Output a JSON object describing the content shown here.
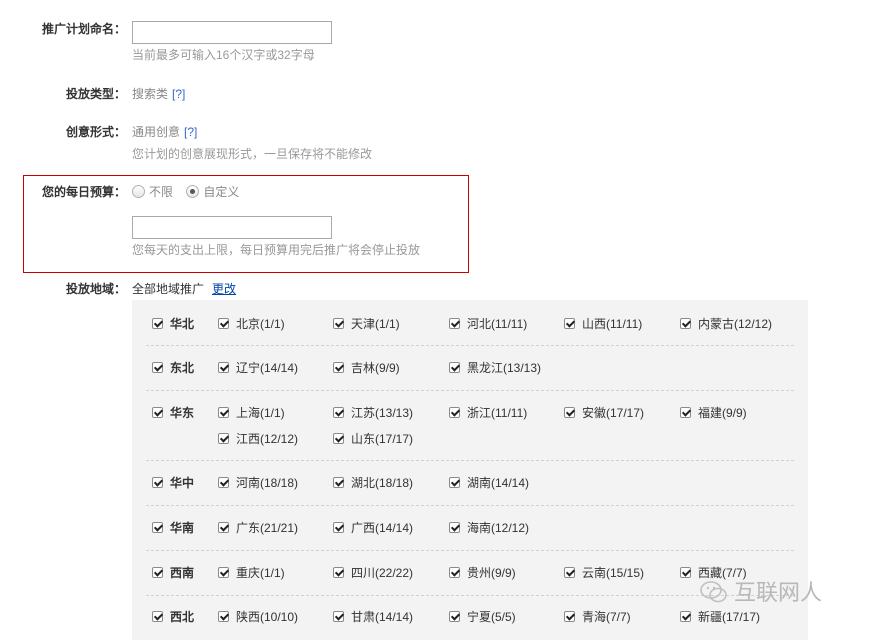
{
  "campaign_name": {
    "label": "推广计划命名：",
    "value": "",
    "hint": "当前最多可输入16个汉字或32字母"
  },
  "placement_type": {
    "label": "投放类型：",
    "value": "搜索类",
    "help": "[?]"
  },
  "creative_format": {
    "label": "创意形式：",
    "value": "通用创意",
    "help": "[?]",
    "hint": "您计划的创意展现形式，一旦保存将不能修改"
  },
  "daily_budget": {
    "label": "您的每日预算：",
    "options": [
      {
        "label": "不限",
        "selected": false
      },
      {
        "label": "自定义",
        "selected": true
      }
    ],
    "value": "",
    "hint": "您每天的支出上限，每日预算用完后推广将会停止投放",
    "highlight_color": "#cc0000"
  },
  "regions": {
    "label": "投放地域：",
    "value": "全部地域推广",
    "change_link": "更改",
    "groups": [
      {
        "name": "华北",
        "items": [
          "北京(1/1)",
          "天津(1/1)",
          "河北(11/11)",
          "山西(11/11)",
          "内蒙古(12/12)"
        ]
      },
      {
        "name": "东北",
        "items": [
          "辽宁(14/14)",
          "吉林(9/9)",
          "黑龙江(13/13)"
        ]
      },
      {
        "name": "华东",
        "items": [
          "上海(1/1)",
          "江苏(13/13)",
          "浙江(11/11)",
          "安徽(17/17)",
          "福建(9/9)",
          "江西(12/12)",
          "山东(17/17)"
        ]
      },
      {
        "name": "华中",
        "items": [
          "河南(18/18)",
          "湖北(18/18)",
          "湖南(14/14)"
        ]
      },
      {
        "name": "华南",
        "items": [
          "广东(21/21)",
          "广西(14/14)",
          "海南(12/12)"
        ]
      },
      {
        "name": "西南",
        "items": [
          "重庆(1/1)",
          "四川(22/22)",
          "贵州(9/9)",
          "云南(15/15)",
          "西藏(7/7)"
        ]
      },
      {
        "name": "西北",
        "items": [
          "陕西(10/10)",
          "甘肃(14/14)",
          "宁夏(5/5)",
          "青海(7/7)",
          "新疆(17/17)"
        ]
      }
    ]
  },
  "watermark": {
    "text": "互联网人",
    "icon": "wechat-icon"
  }
}
